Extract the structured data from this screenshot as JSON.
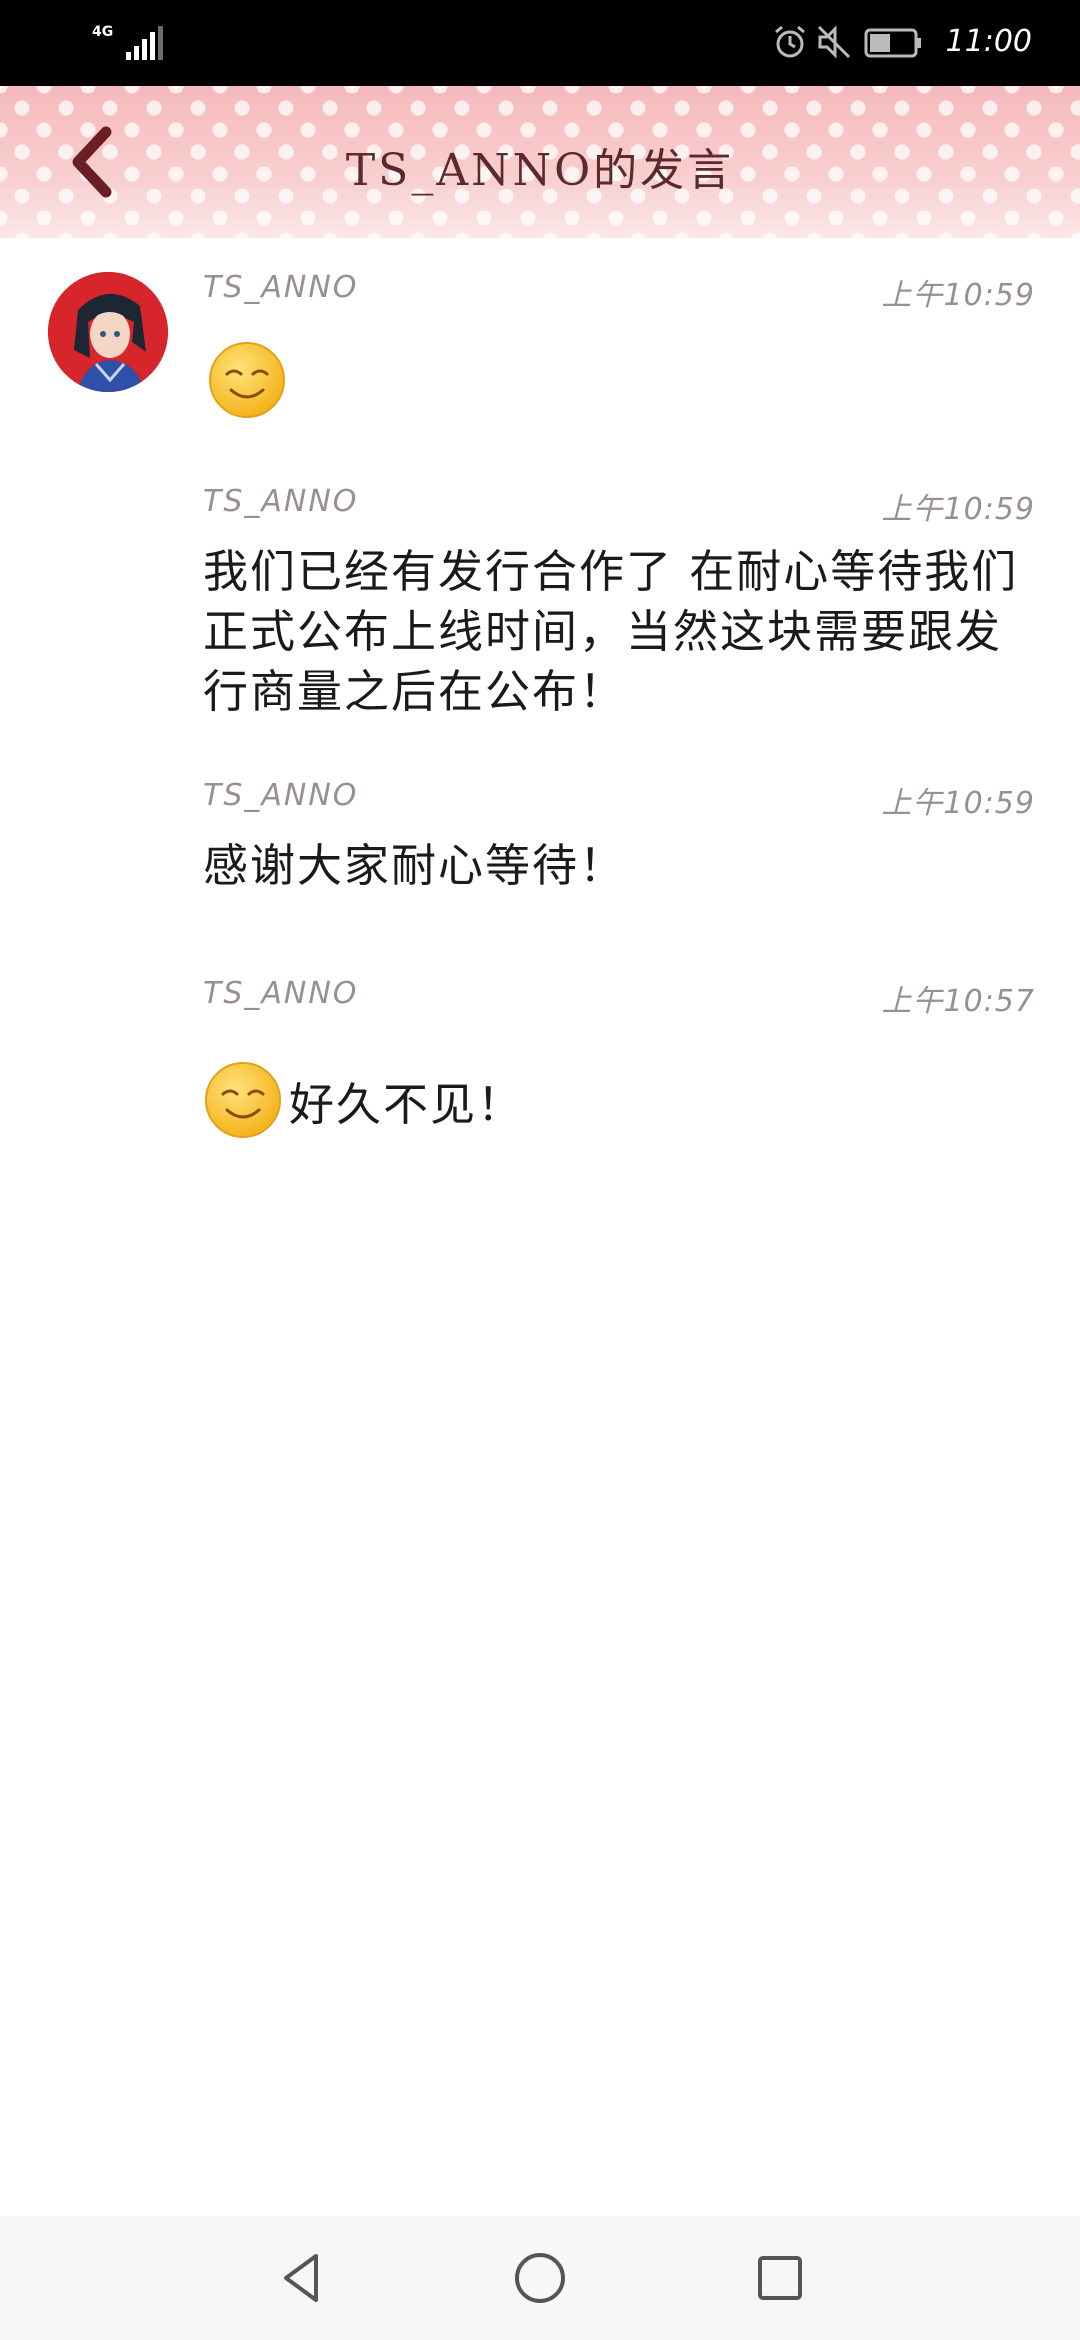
{
  "status_bar": {
    "network": "4G",
    "time": "11:00",
    "icons": [
      "signal-icon",
      "alarm-icon",
      "mute-icon",
      "battery-icon"
    ]
  },
  "header": {
    "title": "TS_ANNO的发言",
    "back_icon": "chevron-left-icon"
  },
  "messages": [
    {
      "author": "TS_ANNO",
      "time": "上午10:59",
      "content_type": "emoji",
      "emoji": "smile-emoji"
    },
    {
      "author": "TS_ANNO",
      "time": "上午10:59",
      "content_type": "text",
      "text": "我们已经有发行合作了 在耐心等待我们正式公布上线时间，当然这块需要跟发行商量之后在公布！"
    },
    {
      "author": "TS_ANNO",
      "time": "上午10:59",
      "content_type": "text",
      "text": "感谢大家耐心等待！"
    },
    {
      "author": "TS_ANNO",
      "time": "上午10:57",
      "content_type": "emoji+text",
      "emoji": "smile-emoji",
      "text": "好久不见！"
    }
  ],
  "nav_bar": {
    "buttons": [
      "back-triangle-icon",
      "home-circle-icon",
      "recents-square-icon"
    ]
  },
  "colors": {
    "status_bar_bg": "#000000",
    "header_pink": "#f7c4c6",
    "title_color": "#5a2a2e",
    "meta_gray": "#9a8f8f",
    "text_color": "#1a1a1a",
    "avatar_red": "#d6252b"
  }
}
